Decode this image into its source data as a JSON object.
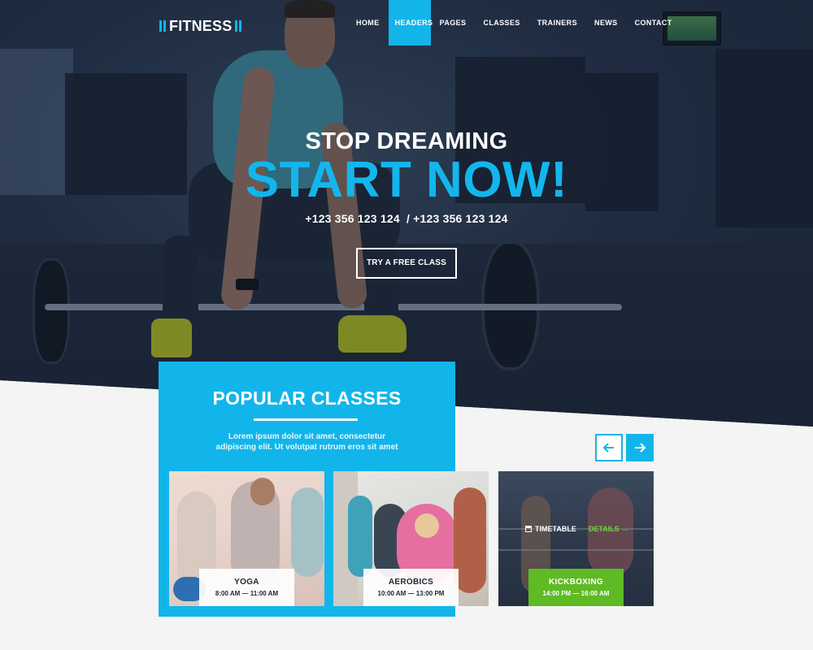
{
  "brand": {
    "name": "FITNESS"
  },
  "nav": {
    "items": [
      {
        "label": "HOME",
        "active": false
      },
      {
        "label": "HEADERS",
        "active": true
      },
      {
        "label": "PAGES",
        "active": false
      },
      {
        "label": "CLASSES",
        "active": false
      },
      {
        "label": "TRAINERS",
        "active": false
      },
      {
        "label": "NEWS",
        "active": false
      },
      {
        "label": "CONTACT",
        "active": false
      }
    ]
  },
  "hero": {
    "subtitle": "STOP DREAMING",
    "title": "START NOW!",
    "phones": "+123 356 123 124  / +123 356 123 124",
    "cta_label": "TRY A FREE CLASS"
  },
  "popular": {
    "title": "POPULAR CLASSES",
    "description": "Lorem ipsum dolor sit amet, consectetur adipiscing elit. Ut volutpat rutrum eros sit amet",
    "prev_icon": "arrow-left-icon",
    "next_icon": "arrow-right-icon"
  },
  "classes": [
    {
      "name": "YOGA",
      "time": "8:00 AM — 11:00 AM"
    },
    {
      "name": "AEROBICS",
      "time": "10:00 AM — 13:00 PM"
    },
    {
      "name": "KICKBOXING",
      "time": "14:00 PM — 16:00 AM",
      "timetable_label": "TIMETABLE",
      "details_label": "DETAILS →"
    }
  ],
  "colors": {
    "accent": "#12b5ea",
    "green": "#5fba24",
    "dark": "#1e2733"
  }
}
